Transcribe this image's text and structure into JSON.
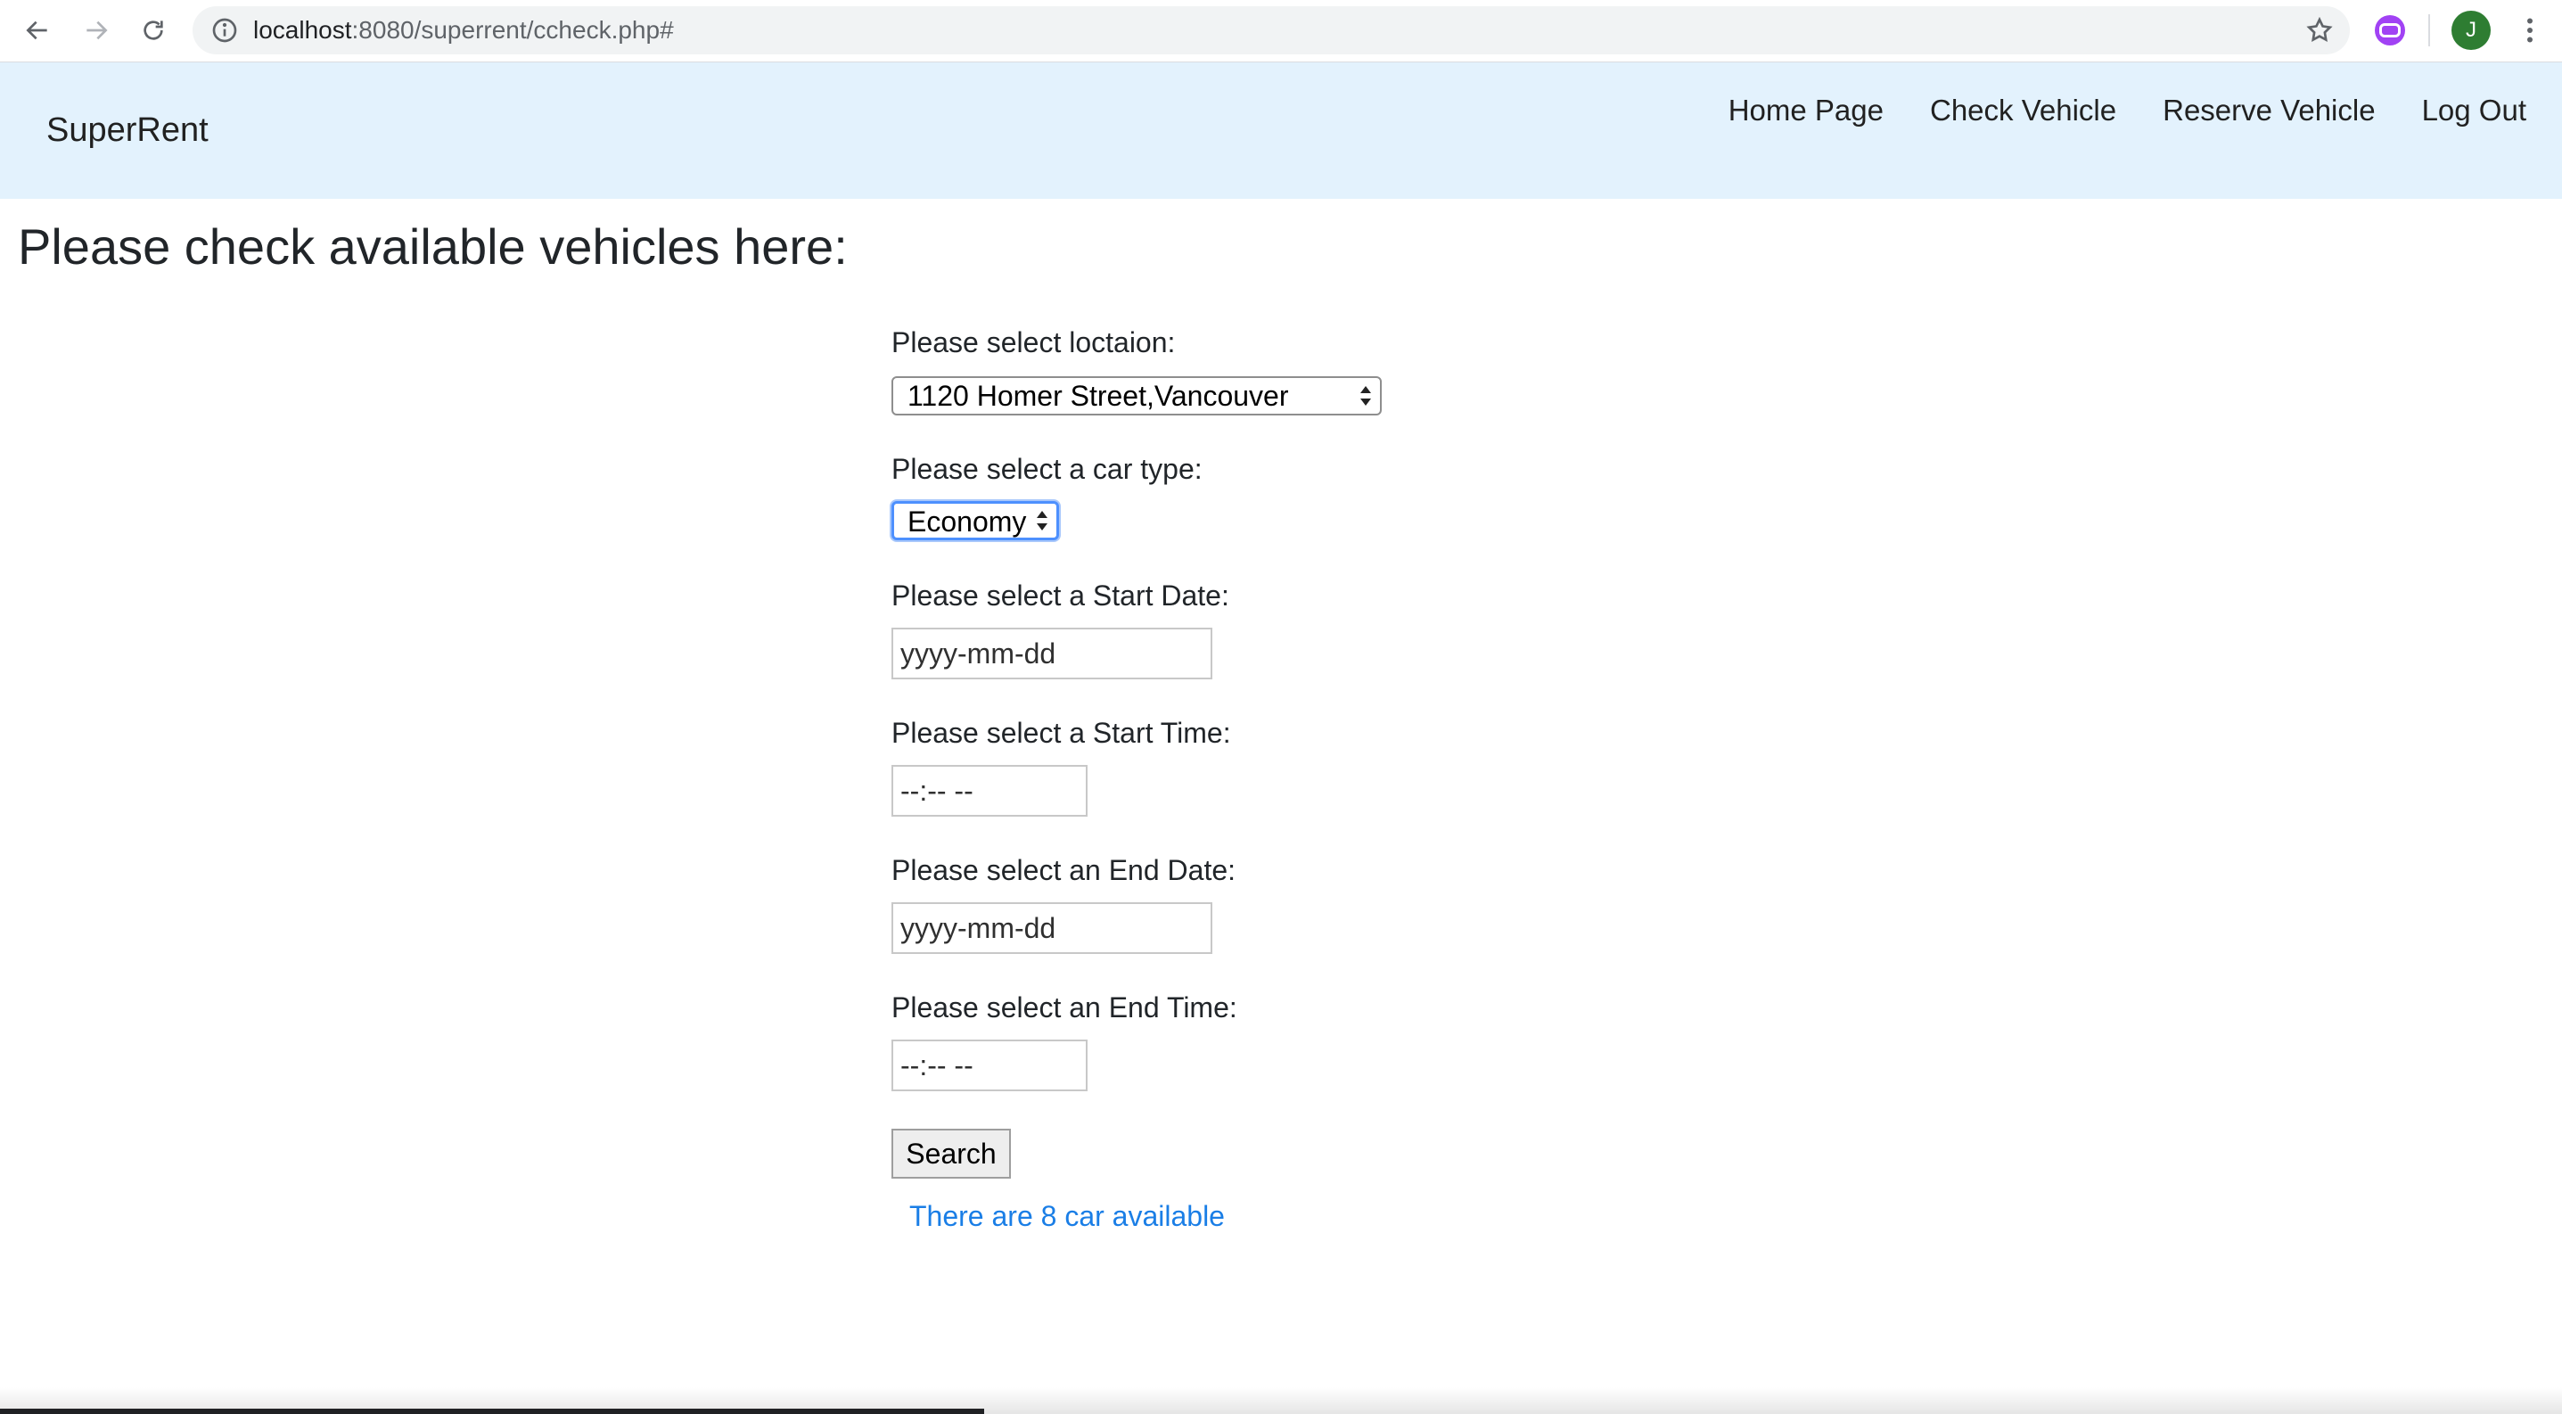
{
  "browser": {
    "url_host": "localhost",
    "url_path": ":8080/superrent/ccheck.php#",
    "profile_initial": "J"
  },
  "navbar": {
    "brand": "SuperRent",
    "links": [
      "Home Page",
      "Check Vehicle",
      "Reserve Vehicle",
      "Log Out"
    ]
  },
  "page": {
    "title": "Please check available vehicles here:"
  },
  "form": {
    "location_label": "Please select loctaion:",
    "location_value": "1120 Homer Street,Vancouver",
    "car_type_label": "Please select a car type:",
    "car_type_value": "Economy",
    "start_date_label": "Please select a Start Date:",
    "start_date_value": "yyyy-mm-dd",
    "start_time_label": "Please select a Start Time:",
    "start_time_value": "--:-- --",
    "end_date_label": "Please select an End Date:",
    "end_date_value": "yyyy-mm-dd",
    "end_time_label": "Please select an End Time:",
    "end_time_value": "--:-- --",
    "search_label": "Search"
  },
  "result": {
    "message": "There are 8 car available",
    "color": "#1a7ee6"
  },
  "icons": {
    "back": "back-arrow-icon",
    "forward": "forward-arrow-icon",
    "reload": "reload-icon",
    "info": "info-icon",
    "star": "star-icon",
    "extension": "extension-icon",
    "menu": "kebab-menu-icon"
  }
}
